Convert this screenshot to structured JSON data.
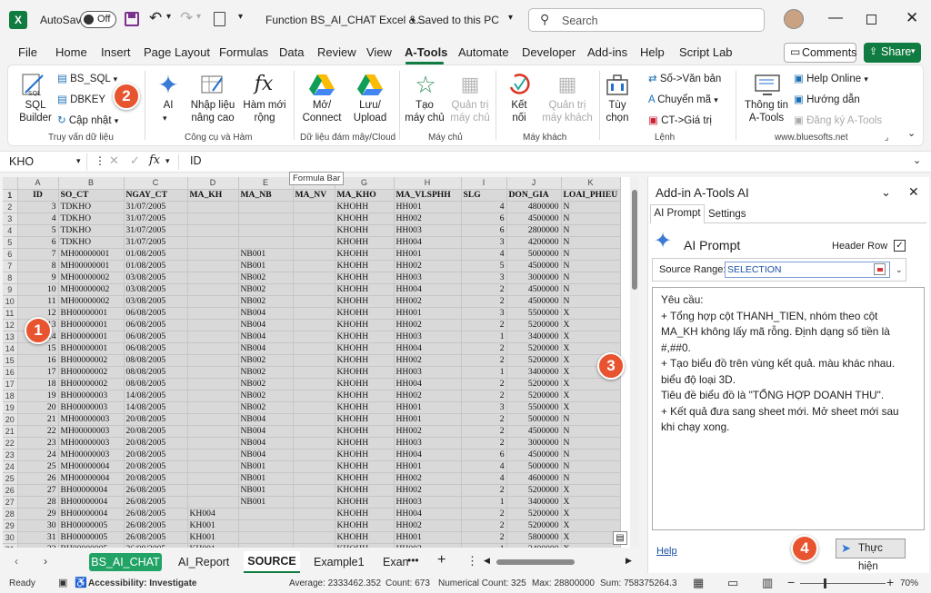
{
  "titlebar": {
    "autosave": "AutoSave",
    "autosave_state": "Off",
    "filename": "Function BS_AI_CHAT Excel &...",
    "saved": "• Saved to this PC",
    "search_placeholder": "Search"
  },
  "tabs": [
    "File",
    "Home",
    "Insert",
    "Page Layout",
    "Formulas",
    "Data",
    "Review",
    "View",
    "A-Tools",
    "Automate",
    "Developer",
    "Add-ins",
    "Help",
    "Script Lab"
  ],
  "active_tab": "A-Tools",
  "comments": "Comments",
  "share": "Share",
  "ribbon": {
    "sql_builder": "SQL\nBuilder",
    "bs_sql": "BS_SQL",
    "dbkey": "DBKEY",
    "cap_nhat": "Cập nhật",
    "g1": "Truy vấn dữ liệu",
    "ai": "AI",
    "nhap_lieu": "Nhập liệu\nnâng cao",
    "ham_moi": "Hàm mới\nrộng",
    "g2": "Công cụ và Hàm",
    "mo_connect": "Mở/\nConnect",
    "luu_upload": "Lưu/\nUpload",
    "g3": "Dữ liệu đám mây/Cloud",
    "tao_may_chu": "Tạo\nmáy chủ",
    "quan_tri_may_chu": "Quản trị\nmáy chủ",
    "g4": "Máy chủ",
    "ket_noi": "Kết\nnối",
    "quan_tri_may_khach": "Quản trị\nmáy khách",
    "g5": "Máy khách",
    "tuy_chon": "Tùy\nchọn",
    "so_van_ban": "Số->Văn bản",
    "chuyen_ma": "Chuyển mã",
    "ct_gia_tri": "CT->Giá trị",
    "g6": "Lệnh",
    "thong_tin": "Thông tin\nA-Tools",
    "help_online": "Help Online",
    "huong_dan": "Hướng dẫn",
    "dang_ky": "Đăng ký A-Tools",
    "g7": "www.bluesofts.net"
  },
  "formula_bar": {
    "name_box": "KHO",
    "fx": "fx",
    "value": "ID",
    "tooltip": "Formula Bar"
  },
  "grid": {
    "cols": [
      "A",
      "B",
      "C",
      "D",
      "E",
      "F",
      "G",
      "H",
      "I",
      "J",
      "K"
    ],
    "rows": [
      [
        "ID",
        "SO_CT",
        "NGAY_CT",
        "MA_KH",
        "MA_NB",
        "MA_NV",
        "MA_KHO",
        "MA_VLSPHH",
        "SLG",
        "DON_GIA",
        "LOAI_PHIEU"
      ],
      [
        "3",
        "TDKHO",
        "31/07/2005",
        "",
        "",
        "",
        "KHOHH",
        "HH001",
        "4",
        "4800000",
        "N"
      ],
      [
        "4",
        "TDKHO",
        "31/07/2005",
        "",
        "",
        "",
        "KHOHH",
        "HH002",
        "6",
        "4500000",
        "N"
      ],
      [
        "5",
        "TDKHO",
        "31/07/2005",
        "",
        "",
        "",
        "KHOHH",
        "HH003",
        "6",
        "2800000",
        "N"
      ],
      [
        "6",
        "TDKHO",
        "31/07/2005",
        "",
        "",
        "",
        "KHOHH",
        "HH004",
        "3",
        "4200000",
        "N"
      ],
      [
        "7",
        "MH00000001",
        "01/08/2005",
        "",
        "NB001",
        "",
        "KHOHH",
        "HH001",
        "4",
        "5000000",
        "N"
      ],
      [
        "8",
        "MH00000001",
        "01/08/2005",
        "",
        "NB001",
        "",
        "KHOHH",
        "HH002",
        "5",
        "4500000",
        "N"
      ],
      [
        "9",
        "MH00000002",
        "03/08/2005",
        "",
        "NB002",
        "",
        "KHOHH",
        "HH003",
        "3",
        "3000000",
        "N"
      ],
      [
        "10",
        "MH00000002",
        "03/08/2005",
        "",
        "NB002",
        "",
        "KHOHH",
        "HH004",
        "2",
        "4500000",
        "N"
      ],
      [
        "11",
        "MH00000002",
        "03/08/2005",
        "",
        "NB002",
        "",
        "KHOHH",
        "HH002",
        "2",
        "4500000",
        "N"
      ],
      [
        "12",
        "BH00000001",
        "06/08/2005",
        "",
        "NB004",
        "",
        "KHOHH",
        "HH001",
        "3",
        "5500000",
        "X"
      ],
      [
        "13",
        "BH00000001",
        "06/08/2005",
        "",
        "NB004",
        "",
        "KHOHH",
        "HH002",
        "2",
        "5200000",
        "X"
      ],
      [
        "14",
        "BH00000001",
        "06/08/2005",
        "",
        "NB004",
        "",
        "KHOHH",
        "HH003",
        "1",
        "3400000",
        "X"
      ],
      [
        "15",
        "BH00000001",
        "06/08/2005",
        "",
        "NB004",
        "",
        "KHOHH",
        "HH004",
        "2",
        "5200000",
        "X"
      ],
      [
        "16",
        "BH00000002",
        "08/08/2005",
        "",
        "NB002",
        "",
        "KHOHH",
        "HH002",
        "2",
        "5200000",
        "X"
      ],
      [
        "17",
        "BH00000002",
        "08/08/2005",
        "",
        "NB002",
        "",
        "KHOHH",
        "HH003",
        "1",
        "3400000",
        "X"
      ],
      [
        "18",
        "BH00000002",
        "08/08/2005",
        "",
        "NB002",
        "",
        "KHOHH",
        "HH004",
        "2",
        "5200000",
        "X"
      ],
      [
        "19",
        "BH00000003",
        "14/08/2005",
        "",
        "NB002",
        "",
        "KHOHH",
        "HH002",
        "2",
        "5200000",
        "X"
      ],
      [
        "20",
        "BH00000003",
        "14/08/2005",
        "",
        "NB002",
        "",
        "KHOHH",
        "HH001",
        "3",
        "5500000",
        "X"
      ],
      [
        "21",
        "MH00000003",
        "20/08/2005",
        "",
        "NB004",
        "",
        "KHOHH",
        "HH001",
        "2",
        "5000000",
        "N"
      ],
      [
        "22",
        "MH00000003",
        "20/08/2005",
        "",
        "NB004",
        "",
        "KHOHH",
        "HH002",
        "2",
        "4500000",
        "N"
      ],
      [
        "23",
        "MH00000003",
        "20/08/2005",
        "",
        "NB004",
        "",
        "KHOHH",
        "HH003",
        "2",
        "3000000",
        "N"
      ],
      [
        "24",
        "MH00000003",
        "20/08/2005",
        "",
        "NB004",
        "",
        "KHOHH",
        "HH004",
        "6",
        "4500000",
        "N"
      ],
      [
        "25",
        "MH00000004",
        "20/08/2005",
        "",
        "NB001",
        "",
        "KHOHH",
        "HH001",
        "4",
        "5000000",
        "N"
      ],
      [
        "26",
        "MH00000004",
        "20/08/2005",
        "",
        "NB001",
        "",
        "KHOHH",
        "HH002",
        "4",
        "4600000",
        "N"
      ],
      [
        "27",
        "BH00000004",
        "26/08/2005",
        "",
        "NB001",
        "",
        "KHOHH",
        "HH002",
        "2",
        "5200000",
        "X"
      ],
      [
        "28",
        "BH00000004",
        "26/08/2005",
        "",
        "NB001",
        "",
        "KHOHH",
        "HH003",
        "1",
        "3400000",
        "X"
      ],
      [
        "29",
        "BH00000004",
        "26/08/2005",
        "KH004",
        "",
        "",
        "KHOHH",
        "HH004",
        "2",
        "5200000",
        "X"
      ],
      [
        "30",
        "BH00000005",
        "26/08/2005",
        "KH001",
        "",
        "",
        "KHOHH",
        "HH002",
        "2",
        "5200000",
        "X"
      ],
      [
        "31",
        "BH00000005",
        "26/08/2005",
        "KH001",
        "",
        "",
        "KHOHH",
        "HH001",
        "2",
        "5800000",
        "X"
      ],
      [
        "32",
        "BH00000005",
        "26/08/2005",
        "KH001",
        "",
        "",
        "KHOHH",
        "HH003",
        "1",
        "3400000",
        "X"
      ]
    ]
  },
  "sheets": [
    "BS_AI_CHAT",
    "AI_Report",
    "SOURCE",
    "Example1",
    "Exan"
  ],
  "active_sheet": "SOURCE",
  "status": {
    "ready": "Ready",
    "accessibility": "Accessibility: Investigate",
    "average": "Average: 2333462.352",
    "count": "Count: 673",
    "numerical": "Numerical Count: 325",
    "max": "Max: 28800000",
    "sum": "Sum: 758375264.3",
    "zoom": "70%"
  },
  "pane": {
    "title": "Add-in A-Tools AI",
    "tab1": "AI Prompt",
    "tab2": "Settings",
    "heading": "AI Prompt",
    "header_row": "Header Row",
    "source_label": "Source Range:",
    "source_value": "SELECTION",
    "prompt": [
      "Yêu cầu:",
      "+ Tổng hợp cột THANH_TIEN, nhóm theo cột MA_KH  không lấy mã rỗng. Định dạng số tiền là #,##0.",
      "+ Tạo biểu đồ trên vùng kết quả. màu khác nhau. biểu độ loại 3D.",
      "Tiêu đề biểu đồ là \"TỔNG HỢP DOANH THU\".",
      "+ Kết quả đưa sang sheet mới. Mở sheet mới sau khi chạy xong."
    ],
    "help": "Help",
    "run": "Thực hiện"
  },
  "badges": [
    "1",
    "2",
    "3",
    "4"
  ]
}
